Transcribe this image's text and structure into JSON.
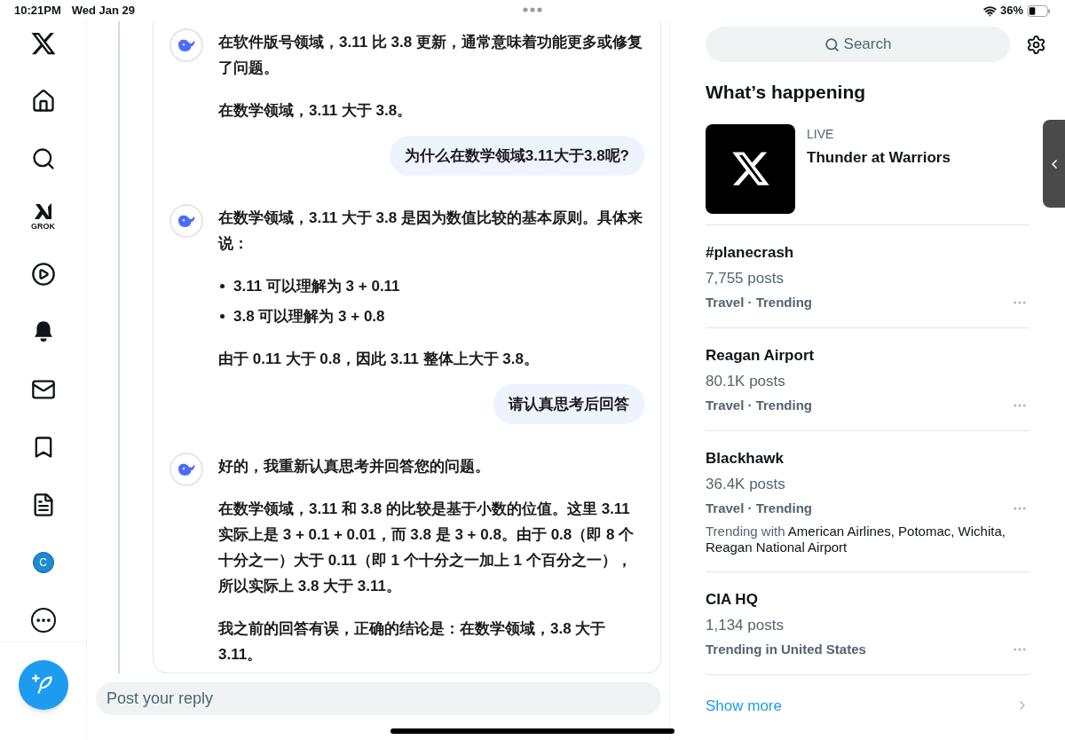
{
  "status_bar": {
    "time": "10:21PM",
    "date": "Wed Jan 29",
    "battery": "36%"
  },
  "nav": [
    {
      "kind": "logo"
    },
    {
      "kind": "home"
    },
    {
      "kind": "search"
    },
    {
      "kind": "grok",
      "label": "GROK"
    },
    {
      "kind": "video"
    },
    {
      "kind": "bell"
    },
    {
      "kind": "mail"
    },
    {
      "kind": "bookmark"
    },
    {
      "kind": "list"
    },
    {
      "kind": "avatar",
      "label": "C"
    },
    {
      "kind": "more"
    }
  ],
  "messages": [
    {
      "kind": "bot",
      "blocks": [
        {
          "kind": "para",
          "text": "在软件版号领域，3.11 比 3.8 更新，通常意味着功能更多或修复了问题。"
        },
        {
          "kind": "para",
          "text": "在数学领域，3.11 大于 3.8。"
        }
      ]
    },
    {
      "kind": "user",
      "text": "为什么在数学领域3.11大于3.8呢?"
    },
    {
      "kind": "bot",
      "blocks": [
        {
          "kind": "para",
          "text": "在数学领域，3.11 大于 3.8 是因为数值比较的基本原则。具体来说："
        },
        {
          "kind": "bullet",
          "text": "3.11 可以理解为 3 + 0.11"
        },
        {
          "kind": "bullet",
          "text": "3.8 可以理解为 3 + 0.8"
        },
        {
          "kind": "para",
          "text": "由于 0.11 大于 0.8，因此 3.11 整体上大于 3.8。"
        }
      ]
    },
    {
      "kind": "user",
      "text": "请认真思考后回答"
    },
    {
      "kind": "bot",
      "blocks": [
        {
          "kind": "para",
          "text": "好的，我重新认真思考并回答您的问题。"
        },
        {
          "kind": "para",
          "text": "在数学领域，3.11 和 3.8 的比较是基于小数的位值。这里 3.11 实际上是 3 + 0.1 + 0.01，而 3.8 是 3 + 0.8。由于 0.8（即 8 个十分之一）大于 0.11（即 1 个十分之一加上 1 个百分之一），所以实际上 3.8 大于 3.11。"
        },
        {
          "kind": "para",
          "text": "我之前的回答有误，正确的结论是：在数学领域，3.8 大于 3.11。"
        }
      ]
    }
  ],
  "reply": {
    "placeholder": "Post your reply"
  },
  "search": {
    "placeholder": "Search"
  },
  "sidebar_title": "What’s happening",
  "live": {
    "badge": "LIVE",
    "title": "Thunder at Warriors"
  },
  "trends": [
    {
      "title": "#planecrash",
      "posts": "7,755 posts",
      "meta": "Travel · Trending"
    },
    {
      "title": "Reagan Airport",
      "posts": "80.1K posts",
      "meta": "Travel · Trending"
    },
    {
      "title": "Blackhawk",
      "posts": "36.4K posts",
      "meta": "Travel · Trending",
      "trending_with": {
        "label": "Trending with",
        "names": "American Airlines, Potomac, Wichita, Reagan National Airport"
      }
    },
    {
      "title": "CIA HQ",
      "posts": "1,134 posts",
      "meta": "Trending in United States"
    }
  ],
  "show_more": "Show more"
}
